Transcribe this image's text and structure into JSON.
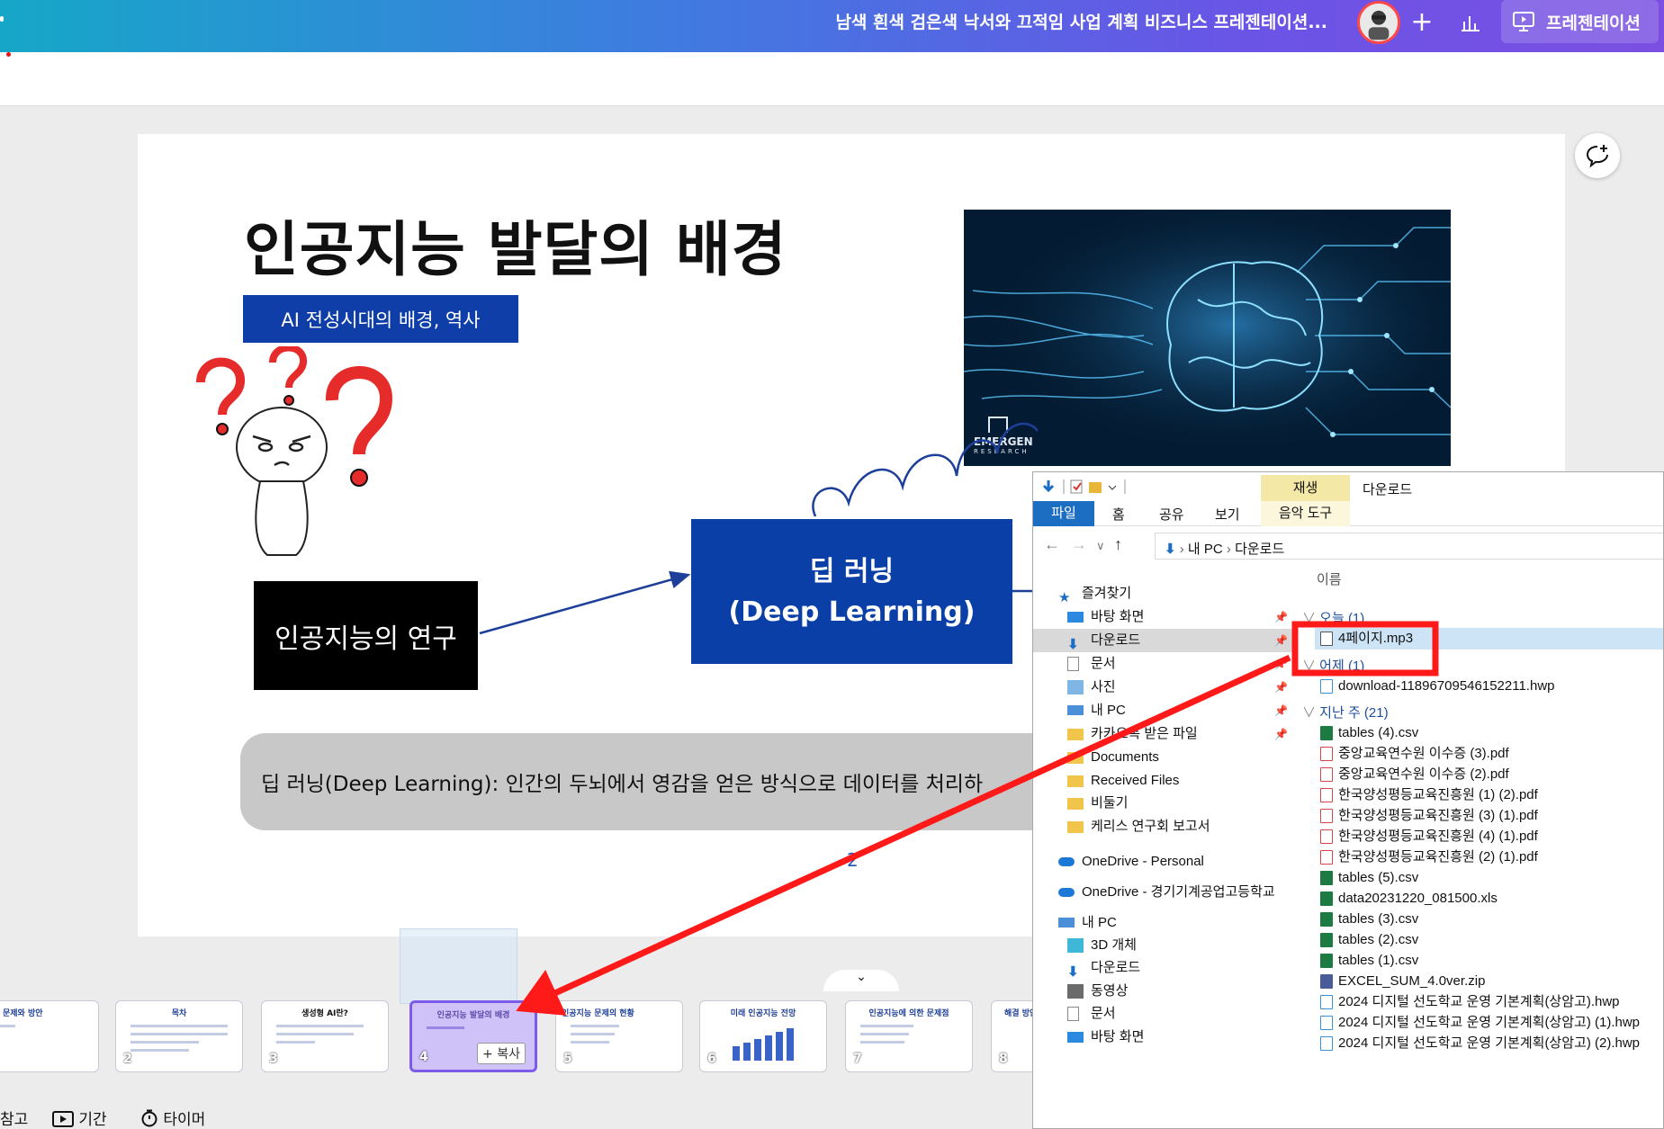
{
  "app": {
    "doc_title": "남색 흰색 검은색 낙서와 끄적임 사업 계획 비즈니스 프레젠테이션...",
    "present_label": "프레젠테이션",
    "accent": "#7c5bea"
  },
  "slide": {
    "title": "인공지능 발달의 배경",
    "subtitle": "AI 전성시대의 배경, 역사",
    "research_box": "인공지능의 연구",
    "deep_line1": "딥 러닝",
    "deep_line2": "(Deep Learning)",
    "image_brand": "EMERGEN",
    "image_brand_tag": "RESEARCH",
    "caption": "딥 러닝(Deep Learning): 인간의 두뇌에서 영감을 얻은 방식으로 데이터를 처리하",
    "page_number": "2",
    "colors": {
      "box_blue": "#0f3ea8",
      "caption_gray": "#c8c8c8"
    }
  },
  "thumbnails": [
    {
      "num": "",
      "title": "문제와 방안"
    },
    {
      "num": "2",
      "title": "목차"
    },
    {
      "num": "3",
      "title": "생성형 AI란?"
    },
    {
      "num": "4",
      "title": "인공지능 발달의 배경",
      "copy_badge": "+ 복사"
    },
    {
      "num": "5",
      "title": "인공지능 문제의 현황"
    },
    {
      "num": "6",
      "title": "미래 인공지능 전망"
    },
    {
      "num": "7",
      "title": "인공지능에 의한 문제점"
    },
    {
      "num": "8",
      "title": "해결 방안"
    }
  ],
  "bottombar": {
    "notes": "참고",
    "duration": "기간",
    "timer": "타이머"
  },
  "explorer": {
    "play_tab": "재생",
    "window_title": "다운로드",
    "tabs": [
      "파일",
      "홈",
      "공유",
      "보기",
      "음악 도구"
    ],
    "path": [
      "내 PC",
      "다운로드"
    ],
    "column_name": "이름",
    "nav": [
      "즐겨찾기",
      "바탕 화면",
      "다운로드",
      "문서",
      "사진",
      "내 PC",
      "카카오톡 받은 파일",
      "Documents",
      "Received Files",
      "비둘기",
      "케리스 연구회 보고서",
      "OneDrive - Personal",
      "OneDrive - 경기기계공업고등학교",
      "내 PC",
      "3D 개체",
      "다운로드",
      "동영상",
      "문서",
      "바탕 화면"
    ],
    "groups": {
      "today": "오늘 (1)",
      "yesterday": "어제 (1)",
      "last_week": "지난 주 (21)"
    },
    "files_today": [
      "4페이지.mp3"
    ],
    "files_yesterday": [
      "download-11896709546152211.hwp"
    ],
    "files_last_week": [
      "tables (4).csv",
      "중앙교육연수원 이수증 (3).pdf",
      "중앙교육연수원 이수증 (2).pdf",
      "한국양성평등교육진흥원 (1) (2).pdf",
      "한국양성평등교육진흥원 (3) (1).pdf",
      "한국양성평등교육진흥원 (4) (1).pdf",
      "한국양성평등교육진흥원 (2) (1).pdf",
      "tables (5).csv",
      "data20231220_081500.xls",
      "tables (3).csv",
      "tables (2).csv",
      "tables (1).csv",
      "EXCEL_SUM_4.0ver.zip",
      "2024 디지털 선도학교 운영 기본계획(상암고).hwp",
      "2024 디지털 선도학교 운영 기본계획(상암고) (1).hwp",
      "2024 디지털 선도학교 운영 기본계획(상암고) (2).hwp"
    ]
  },
  "annotation": {
    "color": "#ff1a1a"
  }
}
